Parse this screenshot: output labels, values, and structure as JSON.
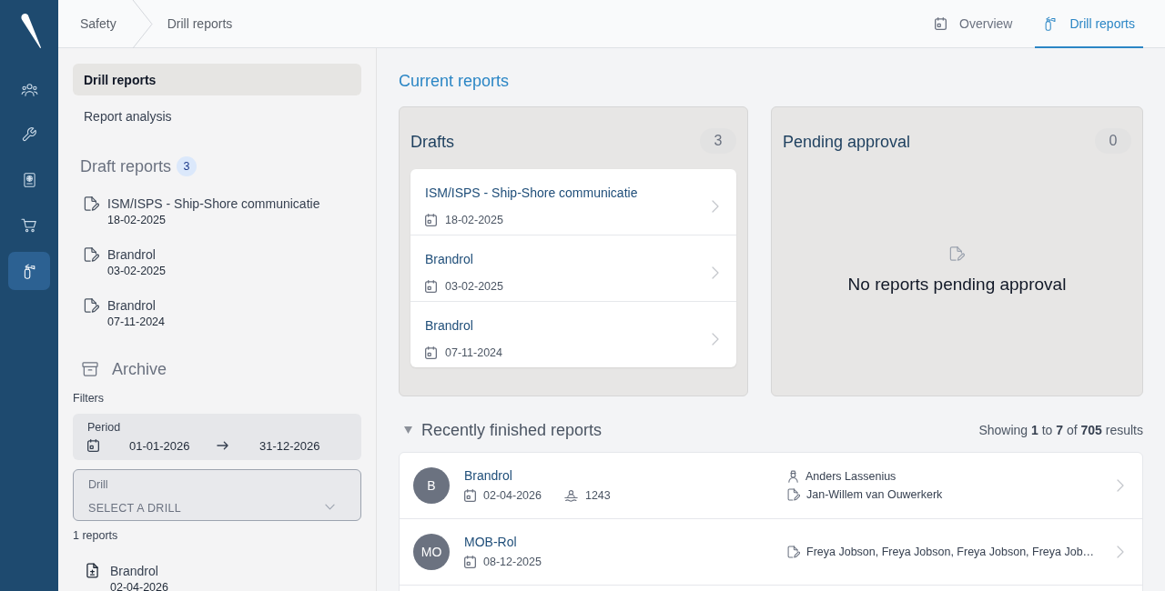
{
  "rail": {
    "items": [
      {
        "selected": false
      },
      {
        "selected": false
      },
      {
        "selected": false
      },
      {
        "selected": false
      },
      {
        "selected": true
      }
    ]
  },
  "breadcrumb": [
    "Safety",
    "Drill reports"
  ],
  "top_tabs": [
    {
      "label": "Overview",
      "selected": false
    },
    {
      "label": "Drill reports",
      "selected": true
    }
  ],
  "sidebar": {
    "nav": [
      {
        "label": "Drill reports",
        "selected": true
      },
      {
        "label": "Report analysis",
        "selected": false
      }
    ],
    "draft_reports": {
      "title": "Draft reports",
      "count": "3",
      "items": [
        {
          "title": "ISM/ISPS - Ship-Shore communicatie",
          "date": "18-02-2025"
        },
        {
          "title": "Brandrol",
          "date": "03-02-2025"
        },
        {
          "title": "Brandrol",
          "date": "07-11-2024"
        }
      ]
    },
    "archive": {
      "title": "Archive",
      "filters_label": "Filters",
      "period": {
        "label": "Period",
        "from": "01-01-2026",
        "to": "31-12-2026"
      },
      "drill_select": {
        "label": "Drill",
        "placeholder": "SELECT A DRILL"
      },
      "result_count": "1 reports",
      "items": [
        {
          "title": "Brandrol",
          "date": "02-04-2026"
        }
      ]
    }
  },
  "current_reports": {
    "title": "Current reports",
    "drafts": {
      "title": "Drafts",
      "count": "3",
      "items": [
        {
          "title": "ISM/ISPS - Ship-Shore communicatie",
          "date": "18-02-2025"
        },
        {
          "title": "Brandrol",
          "date": "03-02-2025"
        },
        {
          "title": "Brandrol",
          "date": "07-11-2024"
        }
      ]
    },
    "pending": {
      "title": "Pending approval",
      "count": "0",
      "empty_message": "No reports pending approval"
    }
  },
  "finished_reports": {
    "title": "Recently finished reports",
    "expanded": true,
    "summary": "Showing **1** to **7** of **705** results",
    "rows": [
      {
        "initials": "B",
        "title": "Brandrol",
        "date": "02-04-2026",
        "crew": "1243",
        "people": [
          {
            "kind": "supervisor",
            "name": "Anders Lassenius"
          },
          {
            "kind": "author",
            "name": "Jan-Willem van Ouwerkerk"
          }
        ]
      },
      {
        "initials": "MO",
        "title": "MOB-Rol",
        "date": "08-12-2025",
        "people": [
          {
            "kind": "author",
            "name": "Freya Jobson, Freya Jobson, Freya Jobson, Freya Job…"
          }
        ]
      }
    ]
  }
}
